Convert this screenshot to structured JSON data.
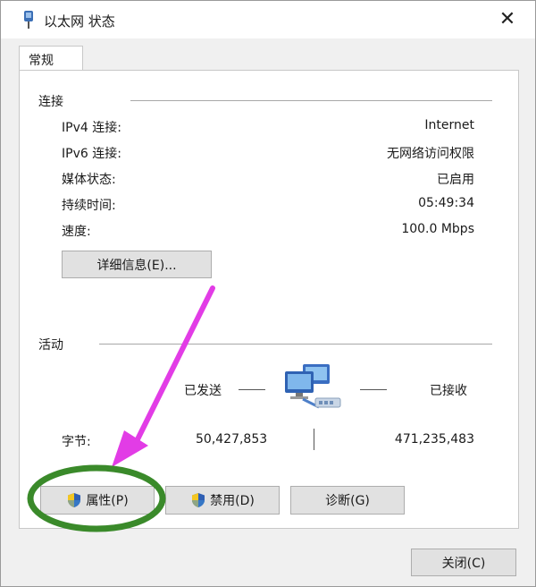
{
  "window": {
    "title": "以太网 状态",
    "close_glyph": "✕"
  },
  "tabs": [
    {
      "label": "常规",
      "active": true
    }
  ],
  "connection": {
    "section_label": "连接",
    "rows": [
      {
        "label": "IPv4 连接:",
        "value": "Internet"
      },
      {
        "label": "IPv6 连接:",
        "value": "无网络访问权限"
      },
      {
        "label": "媒体状态:",
        "value": "已启用"
      },
      {
        "label": "持续时间:",
        "value": "05:49:34"
      },
      {
        "label": "速度:",
        "value": "100.0 Mbps"
      }
    ],
    "details_button": "详细信息(E)..."
  },
  "activity": {
    "section_label": "活动",
    "sent_label": "已发送",
    "received_label": "已接收",
    "bytes_label": "字节:",
    "bytes_sent": "50,427,853",
    "bytes_received": "471,235,483"
  },
  "buttons": {
    "properties": "属性(P)",
    "disable": "禁用(D)",
    "diagnose": "诊断(G)",
    "close": "关闭(C)"
  },
  "icons": {
    "title": "network-cable-icon",
    "activity": "network-computers-icon",
    "shield": "uac-shield-icon"
  },
  "colors": {
    "annotation_arrow": "#e23ce6",
    "annotation_circle": "#3a8a2a",
    "button_face": "#e1e1e1",
    "panel": "#ffffff",
    "window": "#f0f0f0"
  }
}
